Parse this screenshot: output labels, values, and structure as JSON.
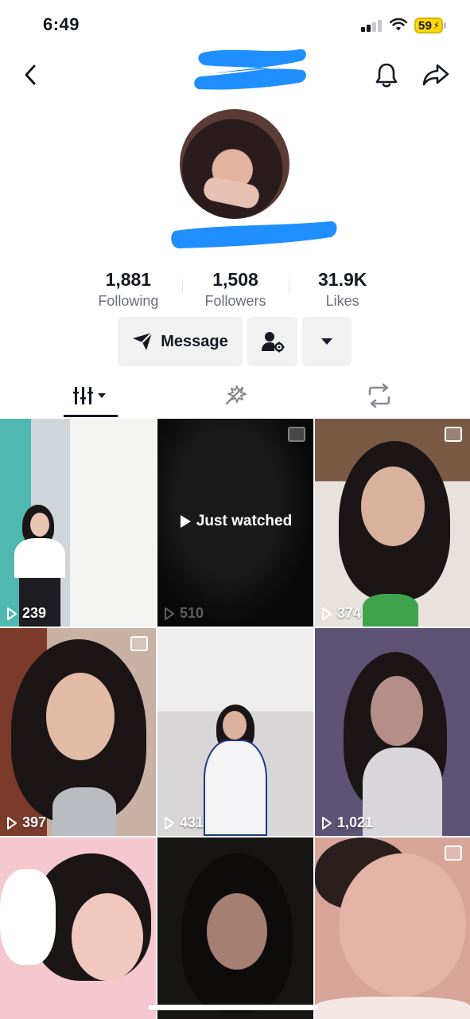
{
  "status_bar": {
    "time": "6:49",
    "battery": "59"
  },
  "profile": {
    "stats": [
      {
        "count": "1,881",
        "label": "Following"
      },
      {
        "count": "1,508",
        "label": "Followers"
      },
      {
        "count": "31.9K",
        "label": "Likes"
      }
    ]
  },
  "actions": {
    "message_label": "Message"
  },
  "tabs": {
    "icons": [
      "videos-grid-icon",
      "liked-icon",
      "repost-icon"
    ]
  },
  "grid": {
    "just_watched_label": "Just watched",
    "items": [
      {
        "views": "239"
      },
      {
        "views": "510"
      },
      {
        "views": "374"
      },
      {
        "views": "397"
      },
      {
        "views": "431"
      },
      {
        "views": "1,021"
      },
      {
        "views": ""
      },
      {
        "views": ""
      },
      {
        "views": ""
      }
    ]
  },
  "colors": {
    "text_primary": "#161823",
    "text_secondary": "#6b6e78",
    "button_bg": "#f1f1f2",
    "redaction_blue": "#1f8fff",
    "battery_yellow": "#ffd60a"
  }
}
